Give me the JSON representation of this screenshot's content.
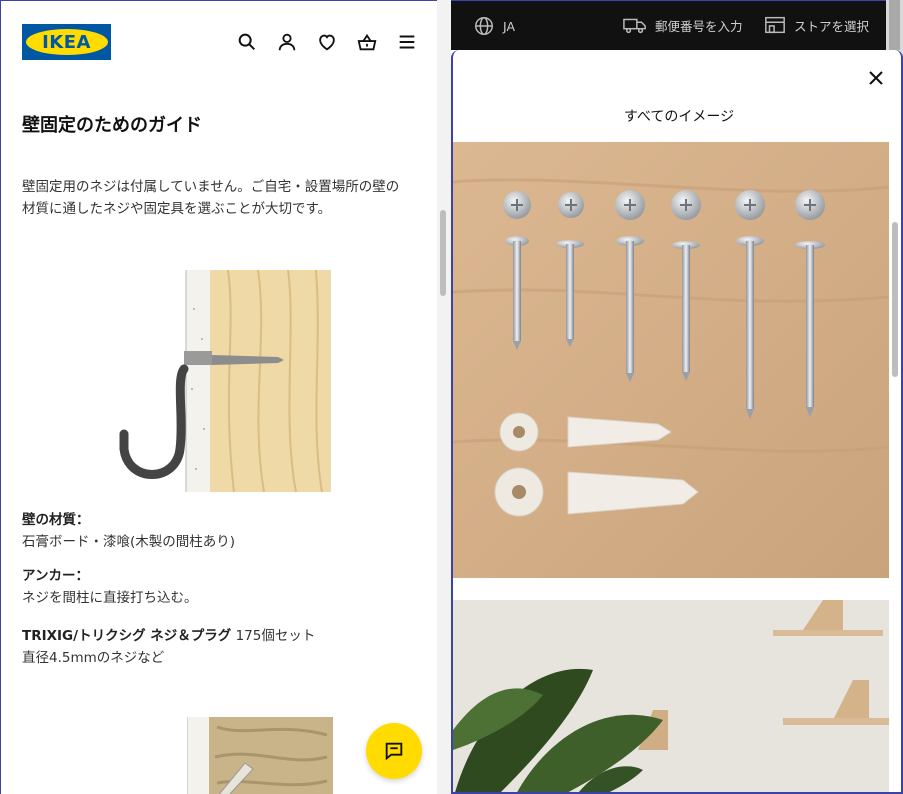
{
  "brand": {
    "logo_text": "IKEA",
    "blue": "#0058a3",
    "yellow": "#ffdb00"
  },
  "header_icons": [
    "search-icon",
    "user-icon",
    "heart-icon",
    "basket-icon",
    "menu-icon"
  ],
  "guide": {
    "title": "壁固定のためのガイド",
    "intro_line1": "壁固定用のネジは付属していません。ご自宅・設置場所の壁の",
    "intro_line2": "材質に通したネジや固定具を選ぶことが大切です。",
    "wall_label": "壁の材質：",
    "wall_value": "石膏ボード・漆喰(木製の間柱あり)",
    "anchor_label": "アンカー：",
    "anchor_value": "ネジを間柱に直接打ち込む。",
    "product_name": "TRIXIG/トリクシグ ネジ＆プラグ",
    "product_qty": " 175個セット",
    "product_detail": "直径4.5mmのネジなど"
  },
  "topbar": {
    "language": "JA",
    "postal": "郵便番号を入力",
    "store": "ストアを選択"
  },
  "panel": {
    "title": "すべてのイメージ"
  },
  "chat": {
    "icon": "chat-icon"
  }
}
